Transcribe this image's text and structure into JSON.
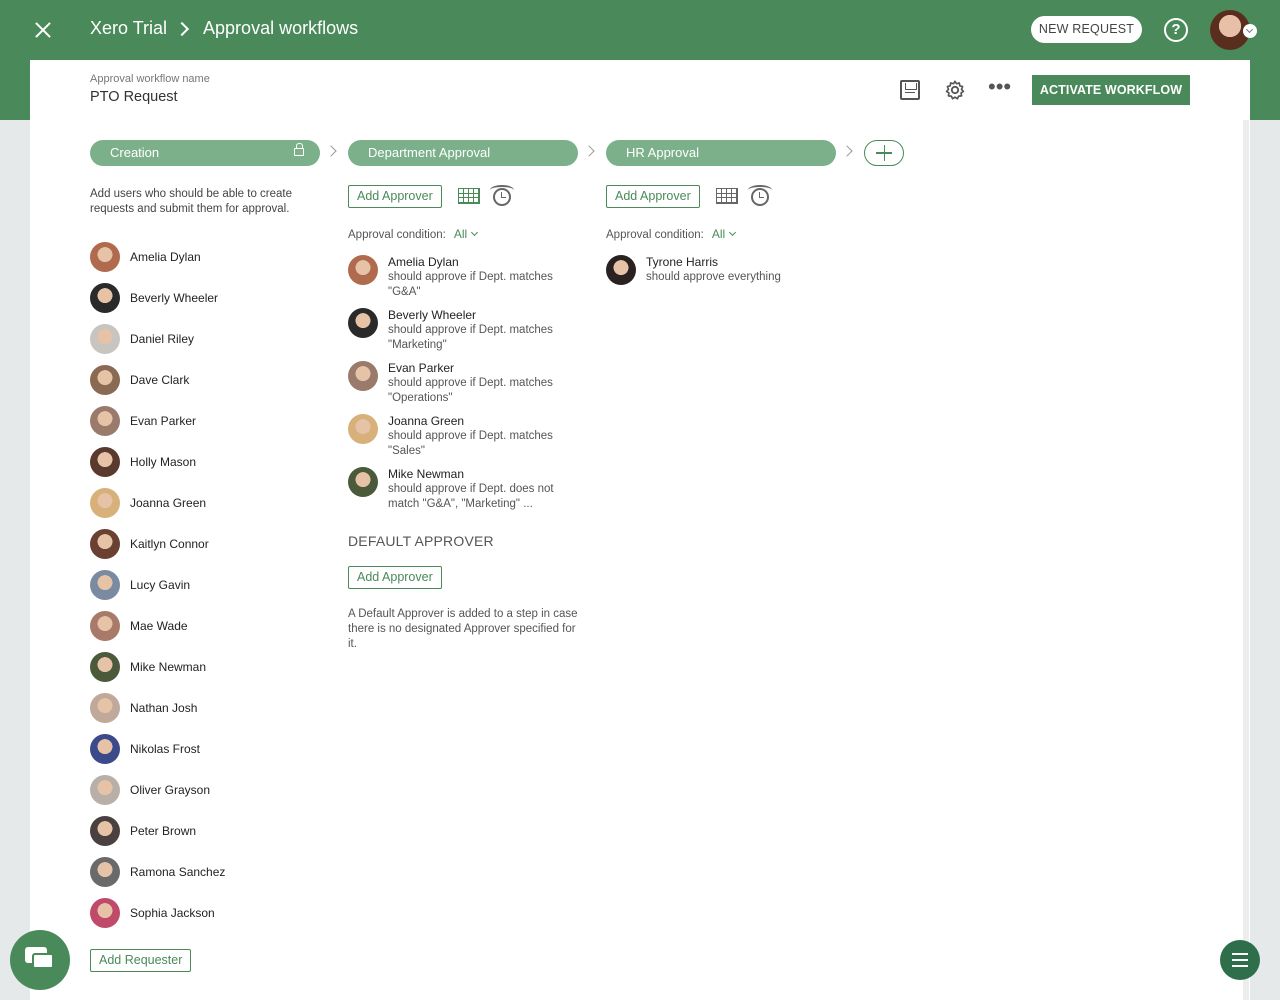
{
  "header": {
    "breadcrumb": [
      "Xero Trial",
      "Approval workflows"
    ],
    "new_request_label": "NEW REQUEST",
    "help_icon": "?"
  },
  "workflow": {
    "name_label": "Approval workflow name",
    "name": "PTO Request",
    "activate_label": "ACTIVATE WORKFLOW"
  },
  "stages": [
    {
      "label": "Creation"
    },
    {
      "label": "Department Approval"
    },
    {
      "label": "HR Approval"
    }
  ],
  "creation": {
    "description": "Add users who should be able to create requests and submit them for approval.",
    "requesters": [
      {
        "name": "Amelia Dylan",
        "color": "#b06a4e"
      },
      {
        "name": "Beverly Wheeler",
        "color": "#2a2a2a"
      },
      {
        "name": "Daniel Riley",
        "color": "#c8c4c0"
      },
      {
        "name": "Dave Clark",
        "color": "#8a6a52"
      },
      {
        "name": "Evan Parker",
        "color": "#9a7a6a"
      },
      {
        "name": "Holly Mason",
        "color": "#5a3a2e"
      },
      {
        "name": "Joanna Green",
        "color": "#d8b07a"
      },
      {
        "name": "Kaitlyn Connor",
        "color": "#6a4030"
      },
      {
        "name": "Lucy Gavin",
        "color": "#7a8aa0"
      },
      {
        "name": "Mae Wade",
        "color": "#a87a6a"
      },
      {
        "name": "Mike Newman",
        "color": "#4a5a3a"
      },
      {
        "name": "Nathan Josh",
        "color": "#c0a89a"
      },
      {
        "name": "Nikolas Frost",
        "color": "#3a4a8a"
      },
      {
        "name": "Oliver Grayson",
        "color": "#b8b0a8"
      },
      {
        "name": "Peter Brown",
        "color": "#4a4040"
      },
      {
        "name": "Ramona Sanchez",
        "color": "#6a6a6a"
      },
      {
        "name": "Sophia Jackson",
        "color": "#c04a6a"
      }
    ],
    "add_requester_label": "Add Requester"
  },
  "department": {
    "add_approver_label": "Add Approver",
    "condition_label": "Approval condition:",
    "condition_value": "All",
    "approvers": [
      {
        "name": "Amelia Dylan",
        "desc": "should approve if Dept. matches \"G&A\"",
        "color": "#b06a4e"
      },
      {
        "name": "Beverly Wheeler",
        "desc": "should approve if Dept. matches \"Marketing\"",
        "color": "#2a2a2a"
      },
      {
        "name": "Evan Parker",
        "desc": "should approve if Dept. matches \"Operations\"",
        "color": "#9a7a6a"
      },
      {
        "name": "Joanna Green",
        "desc": "should approve if Dept. matches \"Sales\"",
        "color": "#d8b07a"
      },
      {
        "name": "Mike Newman",
        "desc": "should approve if Dept. does not match \"G&A\", \"Marketing\" ...",
        "color": "#4a5a3a"
      }
    ],
    "default_heading": "DEFAULT APPROVER",
    "default_add_label": "Add Approver",
    "default_desc": "A Default Approver is added to a step in case there is no designated Approver specified for it."
  },
  "hr": {
    "add_approver_label": "Add Approver",
    "condition_label": "Approval condition:",
    "condition_value": "All",
    "approvers": [
      {
        "name": "Tyrone Harris",
        "desc": "should approve everything",
        "color": "#2a2220"
      }
    ]
  },
  "colors": {
    "brand_green": "#4a8a5a",
    "stage_green": "#7cb08a"
  }
}
